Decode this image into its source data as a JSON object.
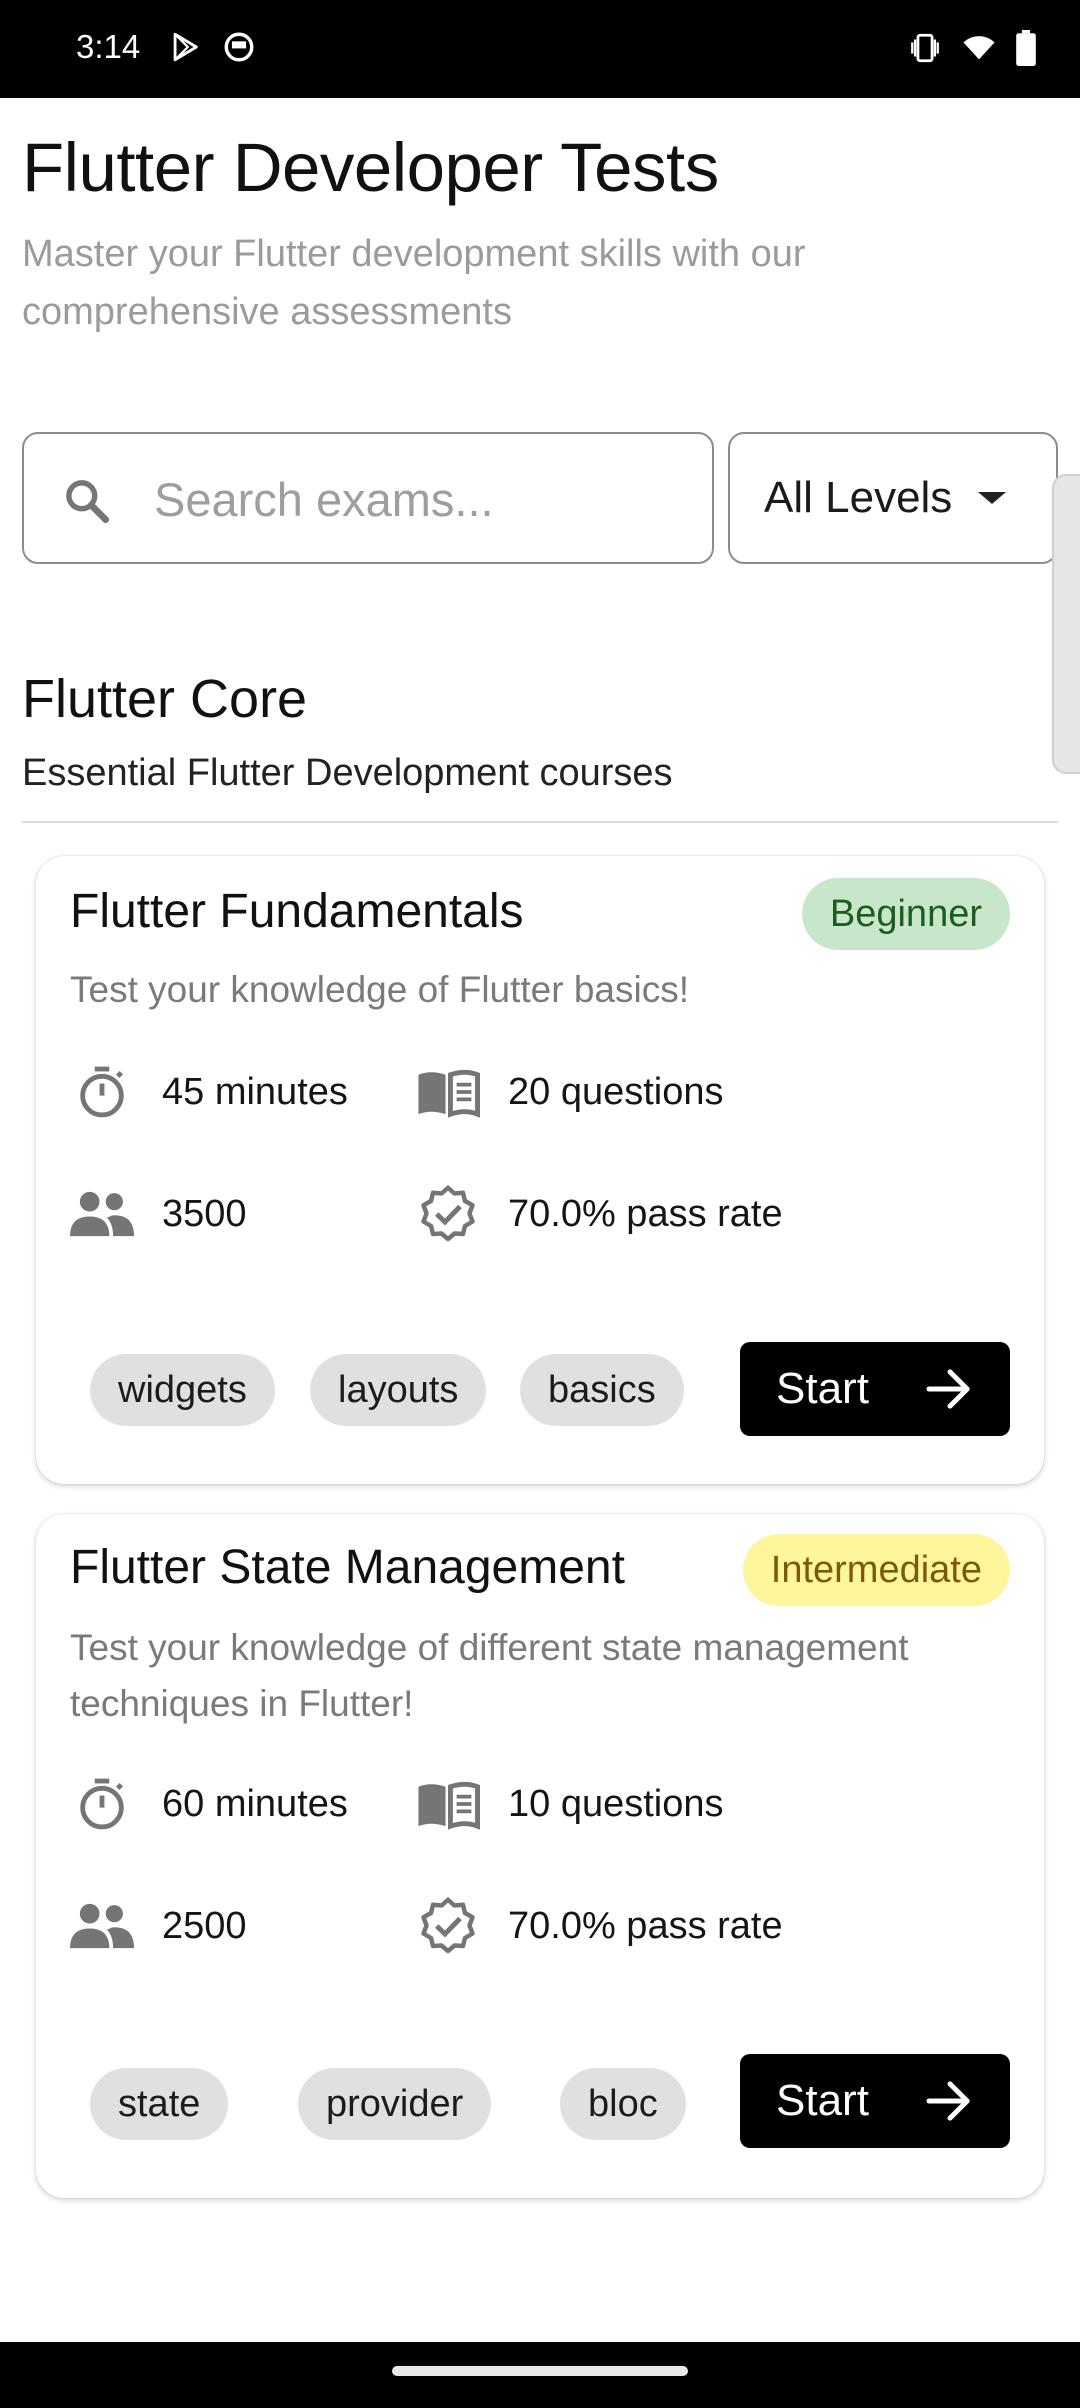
{
  "status_bar": {
    "time": "3:14",
    "icons": [
      "play-store-icon",
      "notification-icon",
      "vibrate-icon",
      "wifi-icon",
      "battery-icon"
    ]
  },
  "header": {
    "title": "Flutter Developer Tests",
    "subtitle": "Master your Flutter development skills with our comprehensive assessments"
  },
  "search": {
    "placeholder": "Search exams...",
    "value": ""
  },
  "level_filter": {
    "selected": "All Levels"
  },
  "section": {
    "title": "Flutter Core",
    "subtitle": "Essential Flutter Development courses"
  },
  "exams": [
    {
      "title": "Flutter Fundamentals",
      "level": "Beginner",
      "level_bg": "#c8e6c9",
      "level_fg": "#1b5e20",
      "description": "Test your knowledge of Flutter basics!",
      "duration": "45 minutes",
      "questions": "20 questions",
      "participants": "3500",
      "pass_rate": "70.0% pass rate",
      "tags": [
        "widgets",
        "layouts",
        "basics"
      ],
      "start_label": "Start"
    },
    {
      "title": "Flutter State Management",
      "level": "Intermediate",
      "level_bg": "#fff59d",
      "level_fg": "#7a5a0d",
      "description": "Test your knowledge of different state management techniques in Flutter!",
      "duration": "60 minutes",
      "questions": "10 questions",
      "participants": "2500",
      "pass_rate": "70.0% pass rate",
      "tags": [
        "state",
        "provider",
        "bloc"
      ],
      "start_label": "Start"
    }
  ]
}
